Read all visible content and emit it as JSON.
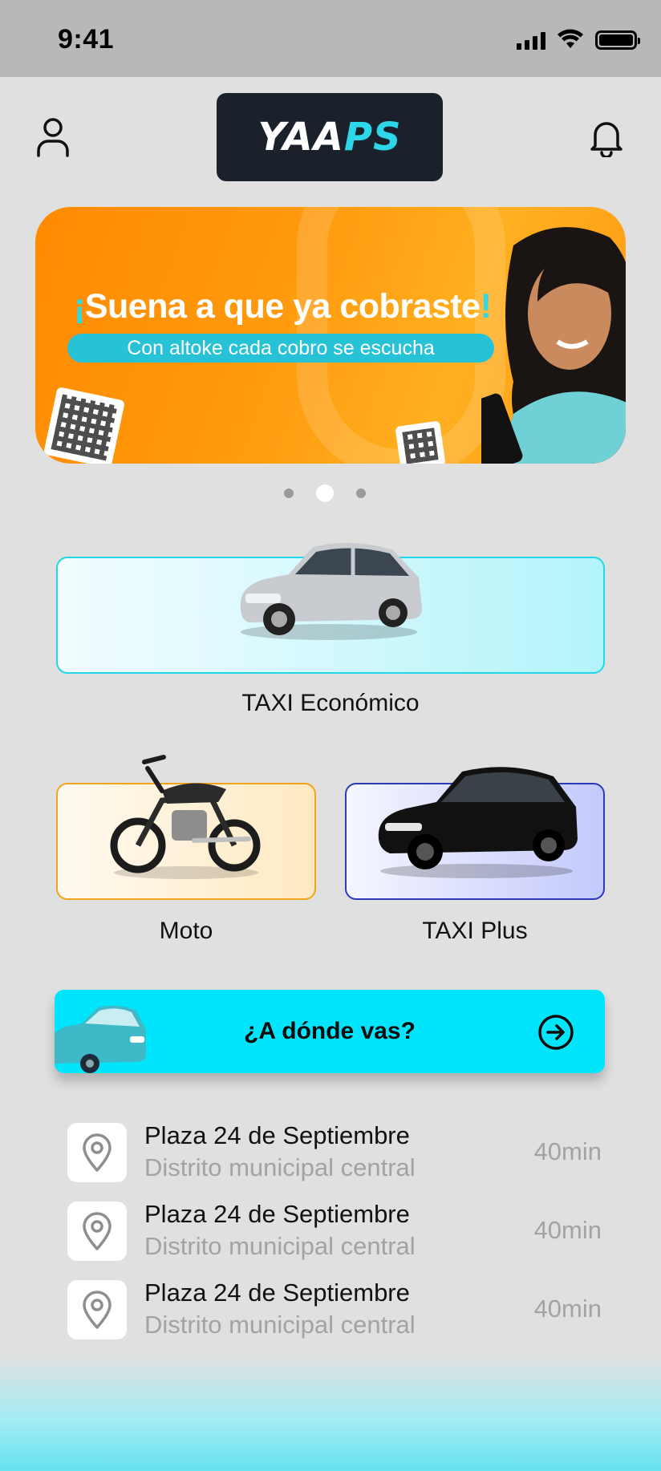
{
  "status_bar": {
    "time": "9:41"
  },
  "header": {
    "logo_part1": "YAA",
    "logo_part2": "PS"
  },
  "banner": {
    "title_mark_open": "¡",
    "title": "Suena a que ya cobraste",
    "title_mark_close": "!",
    "subtitle": "Con altoke cada cobro se escucha",
    "carousel_active_index": 1,
    "carousel_count": 3
  },
  "services": {
    "economico": "TAXI Económico",
    "moto": "Moto",
    "plus": "TAXI Plus"
  },
  "destination": {
    "button_label": "¿A dónde vas?"
  },
  "recent": [
    {
      "title": "Plaza 24 de Septiembre",
      "subtitle": "Distrito municipal central",
      "time": "40min"
    },
    {
      "title": "Plaza 24 de Septiembre",
      "subtitle": "Distrito municipal central",
      "time": "40min"
    },
    {
      "title": "Plaza 24 de Septiembre",
      "subtitle": "Distrito municipal central",
      "time": "40min"
    }
  ],
  "colors": {
    "accent": "#00e5fc",
    "economico_border": "#22d6ea",
    "moto_border": "#f2a51a",
    "plus_border": "#2a3ab8",
    "banner_orange": "#ff8a00"
  },
  "icons": [
    "user-icon",
    "bell-icon",
    "map-pin-icon",
    "arrow-right-circle-icon"
  ]
}
